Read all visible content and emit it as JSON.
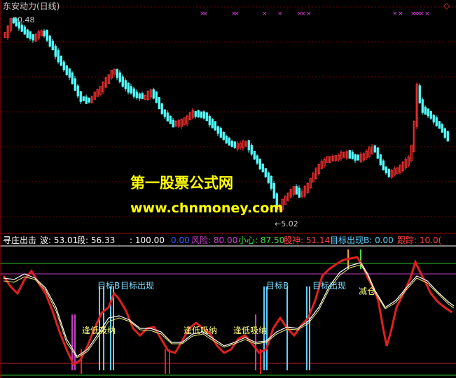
{
  "window": {
    "title": "东安动力(日线)",
    "corner_icon": "diamond-icon"
  },
  "watermark": {
    "line1": "第一股票公式网",
    "line2": "www.chnmoney.com"
  },
  "price": {
    "high_label": "10.48",
    "low_label": "5.02"
  },
  "indicator": {
    "name": "寻庄出击",
    "items": [
      {
        "label": "波: 53.01",
        "color": "#ffffff"
      },
      {
        "label": "段: 56.33",
        "color": "#ffffff"
      },
      {
        "label": ": 100.00",
        "color": "#ffffff"
      },
      {
        "label": "0.00",
        "color": "#3060ff"
      },
      {
        "label": "风险: 80.00",
        "color": "#d040d0"
      },
      {
        "label": "小心: 87.50",
        "color": "#40e040"
      },
      {
        "label": "股神: 51.14",
        "color": "#ff4040"
      },
      {
        "label": "目标出现B: 0.00",
        "color": "#60d0ff"
      },
      {
        "label": "跟踪: 10.0(",
        "color": "#ff4040"
      }
    ],
    "annotations": [
      {
        "text": "目标B",
        "color": "#80e0ff"
      },
      {
        "text": "目标出现",
        "color": "#80e0ff"
      },
      {
        "text": "逢低吸纳",
        "color": "#ffff80"
      },
      {
        "text": "逢低吸纳",
        "color": "#ffff80"
      },
      {
        "text": "逢低吸纳",
        "color": "#ffff80"
      },
      {
        "text": "目标B",
        "color": "#80e0ff"
      },
      {
        "text": "目标出现",
        "color": "#80e0ff"
      },
      {
        "text": "减仓",
        "color": "#ffff80"
      }
    ]
  },
  "colors": {
    "up": "#ff3232",
    "down": "#54ffff",
    "bg": "#000000",
    "grid": "#800000"
  }
}
